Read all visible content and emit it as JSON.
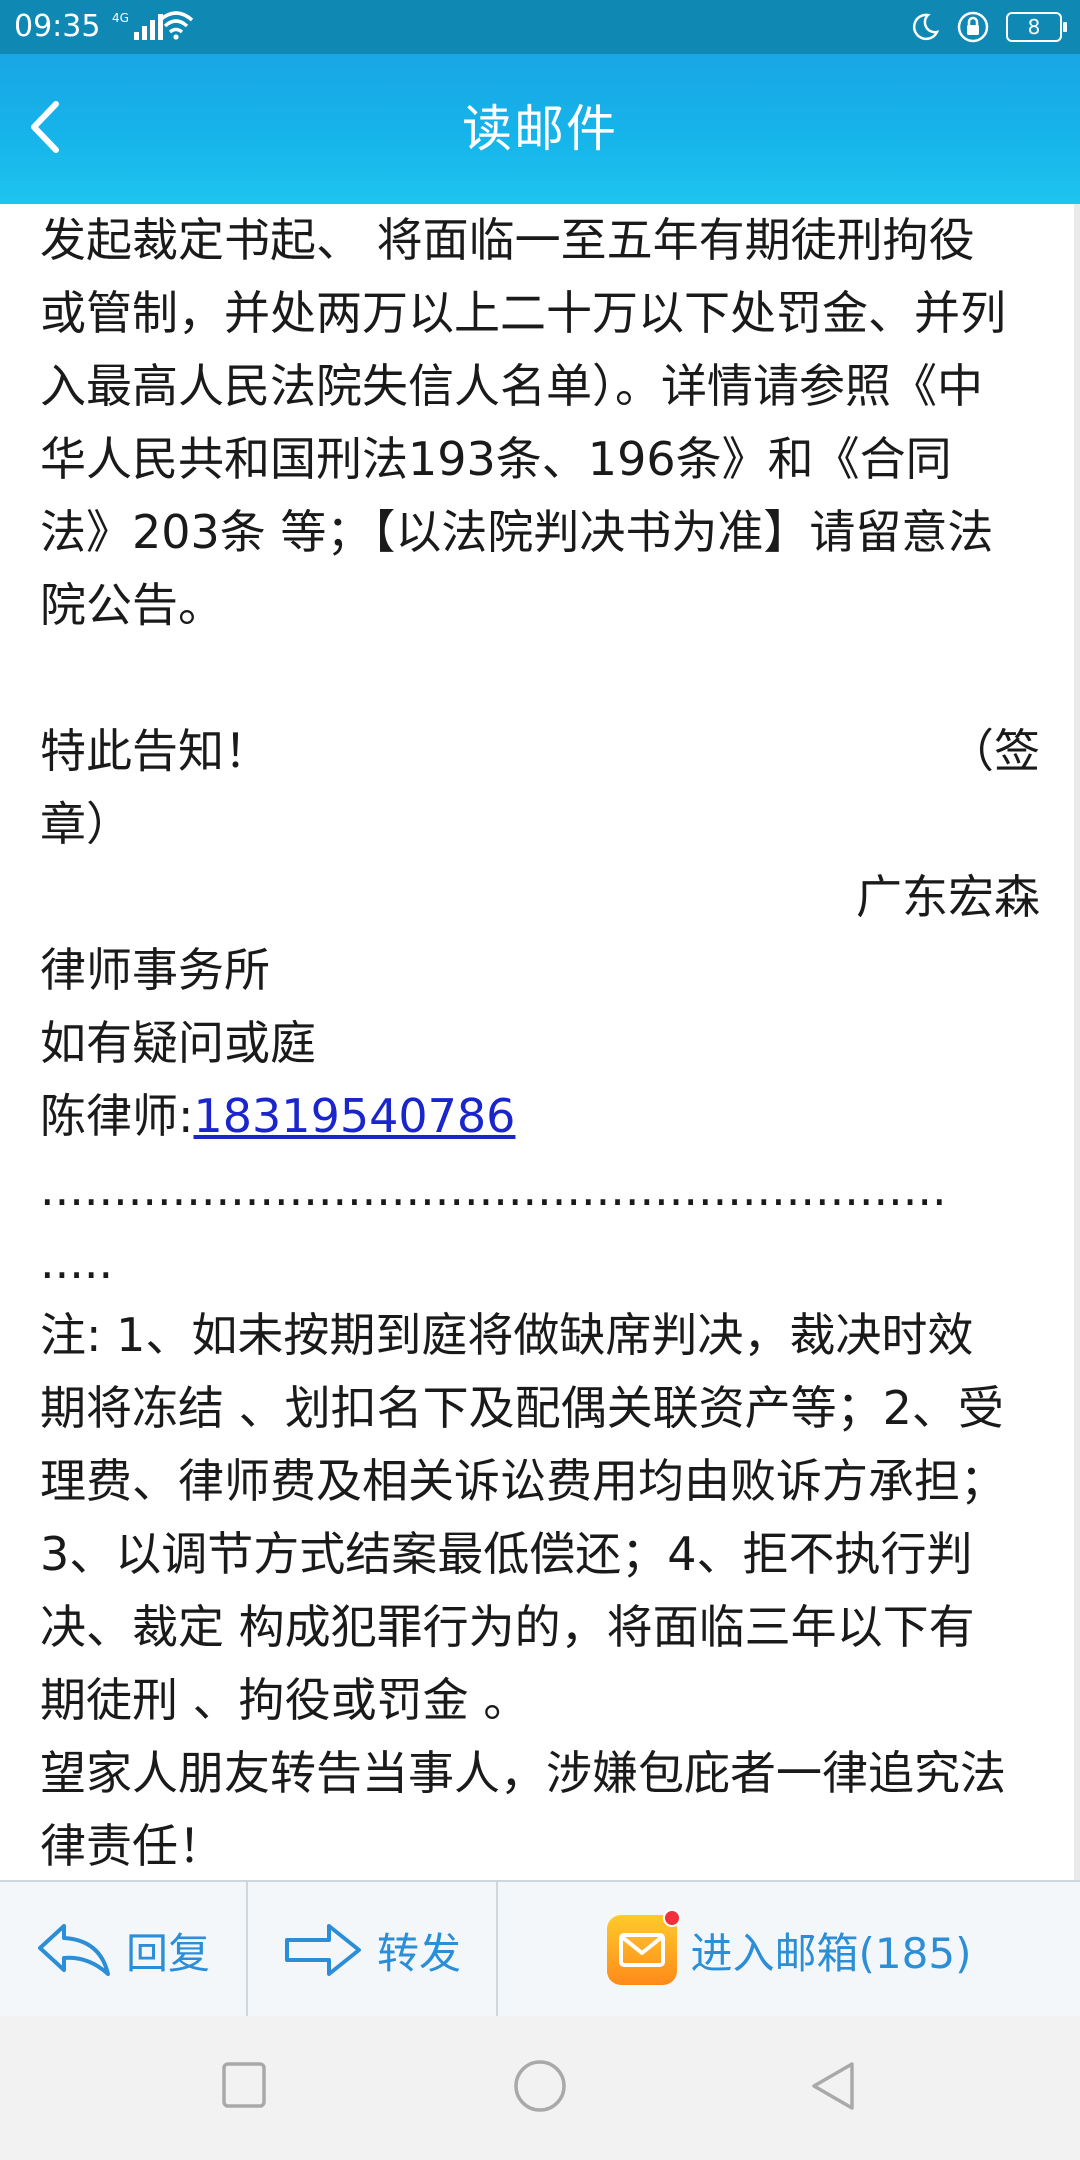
{
  "status_bar": {
    "time": "09:35",
    "network": "4G",
    "battery": "8"
  },
  "header": {
    "title": "读邮件"
  },
  "mail": {
    "paragraph1_lines": [
      "发起裁定书起、 将面临一至五年有期徒刑拘役",
      "或管制，并处两万以上二十万以下处罚金、并列",
      "入最高人民法院失信人名单）。详情请参照《中",
      "华人民共和国刑法193条、196条》和《合同",
      "法》203条 等；【以法院判决书为准】请留意法",
      "院公告。"
    ],
    "notice_left": "特此告知！",
    "notice_right": "（签",
    "seal_end": "章）",
    "firm_right": "广东宏森",
    "firm_line": "律师事务所",
    "question_line": "如有疑问或庭",
    "lawyer_label": "陈律师:",
    "lawyer_phone": "18319540786",
    "dots_line1": "..............................................................",
    "dots_line2": ".....",
    "note_lines": [
      "注: 1、如未按期到庭将做缺席判决，裁决时效",
      "期将冻结 、划扣名下及配偶关联资产等；2、受",
      "理费、律师费及相关诉讼费用均由败诉方承担；",
      "3、以调节方式结案最低偿还；4、拒不执行判",
      "决、裁定 构成犯罪行为的，将面临三年以下有",
      "期徒刑 、拘役或罚金 。",
      "望家人朋友转告当事人，涉嫌包庇者一律追究法",
      "律责任！"
    ]
  },
  "actions": {
    "reply": "回复",
    "forward": "转发",
    "inbox": "进入邮箱(185)"
  },
  "colors": {
    "header_gradient_top": "#19a6e6",
    "header_gradient_bottom": "#1fc4ef",
    "action_text": "#2b8ed6",
    "link": "#1a25cc"
  }
}
